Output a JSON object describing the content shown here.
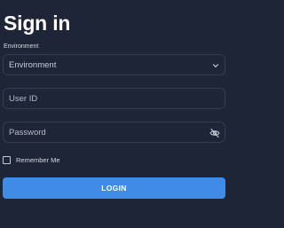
{
  "title": "Sign in",
  "environment": {
    "label": "Environment",
    "selected": "Environment",
    "icon": "chevron-down-icon"
  },
  "user_id": {
    "placeholder": "User ID"
  },
  "password": {
    "placeholder": "Password",
    "icon": "eye-off-icon"
  },
  "remember": {
    "label": "Remember Me",
    "checked": false
  },
  "login": {
    "label": "LOGIN"
  },
  "colors": {
    "background": "#1e2536",
    "accent": "#3f8be6",
    "border": "#343c4e"
  }
}
